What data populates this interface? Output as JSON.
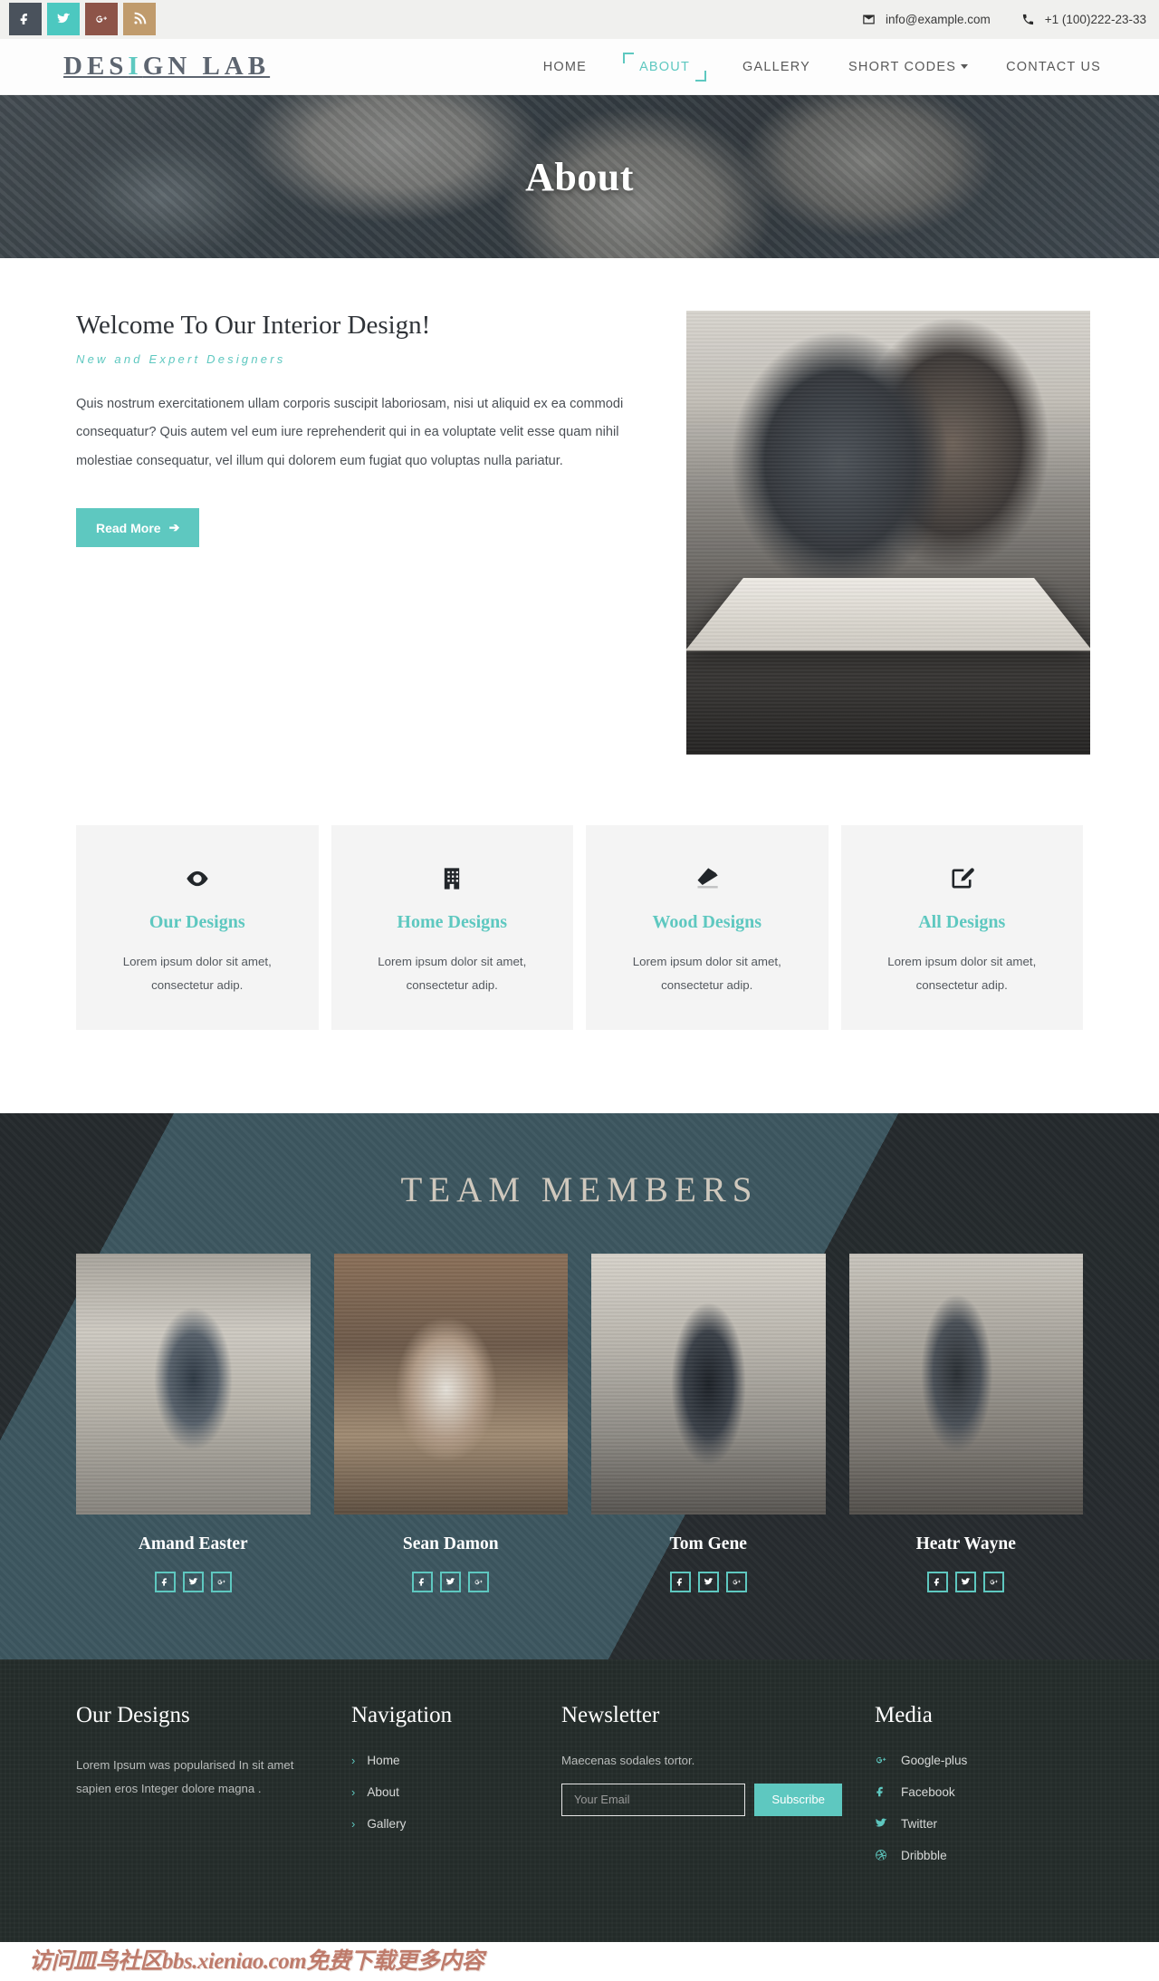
{
  "topbar": {
    "socials": [
      {
        "name": "facebook",
        "icon": "facebook-icon",
        "color": "#4a525c"
      },
      {
        "name": "twitter",
        "icon": "twitter-icon",
        "color": "#4cc8c0"
      },
      {
        "name": "google-plus",
        "icon": "google-plus-icon",
        "color": "#8d5448"
      },
      {
        "name": "rss",
        "icon": "rss-icon",
        "color": "#c09b6c"
      }
    ],
    "email": "info@example.com",
    "phone": "+1 (100)222-23-33"
  },
  "header": {
    "logo_part1": "DES",
    "logo_highlight": "I",
    "logo_part2": "GN LAB",
    "nav": [
      {
        "label": "HOME",
        "active": false,
        "dropdown": false
      },
      {
        "label": "ABOUT",
        "active": true,
        "dropdown": false
      },
      {
        "label": "GALLERY",
        "active": false,
        "dropdown": false
      },
      {
        "label": "SHORT CODES",
        "active": false,
        "dropdown": true
      },
      {
        "label": "CONTACT US",
        "active": false,
        "dropdown": false
      }
    ]
  },
  "hero": {
    "title": "About"
  },
  "welcome": {
    "heading": "Welcome To Our Interior Design!",
    "subheading": "New and Expert Designers",
    "paragraph": "Quis nostrum exercitationem ullam corporis suscipit laboriosam, nisi ut aliquid ex ea commodi consequatur? Quis autem vel eum iure reprehenderit qui in ea voluptate velit esse quam nihil molestiae consequatur, vel illum qui dolorem eum fugiat quo voluptas nulla pariatur.",
    "button": "Read More"
  },
  "cards": [
    {
      "icon": "eye-icon",
      "title": "Our Designs",
      "text": "Lorem ipsum dolor sit amet, consectetur adip."
    },
    {
      "icon": "building-icon",
      "title": "Home Designs",
      "text": "Lorem ipsum dolor sit amet, consectetur adip."
    },
    {
      "icon": "eraser-icon",
      "title": "Wood Designs",
      "text": "Lorem ipsum dolor sit amet, consectetur adip."
    },
    {
      "icon": "pencil-square-icon",
      "title": "All Designs",
      "text": "Lorem ipsum dolor sit amet, consectetur adip."
    }
  ],
  "team": {
    "heading": "TEAM MEMBERS",
    "members": [
      {
        "name": "Amand Easter"
      },
      {
        "name": "Sean Damon"
      },
      {
        "name": "Tom Gene"
      },
      {
        "name": "Heatr Wayne"
      }
    ]
  },
  "footer": {
    "about": {
      "title": "Our Designs",
      "text": "Lorem Ipsum was popularised In sit amet sapien eros Integer dolore magna ."
    },
    "navigation": {
      "title": "Navigation",
      "links": [
        "Home",
        "About",
        "Gallery"
      ]
    },
    "newsletter": {
      "title": "Newsletter",
      "note": "Maecenas sodales tortor.",
      "placeholder": "Your Email",
      "value": "",
      "button": "Subscribe"
    },
    "media": {
      "title": "Media",
      "links": [
        {
          "label": "Google-plus",
          "icon": "google-plus-icon"
        },
        {
          "label": "Facebook",
          "icon": "facebook-icon"
        },
        {
          "label": "Twitter",
          "icon": "twitter-icon"
        },
        {
          "label": "Dribbble",
          "icon": "dribbble-icon"
        }
      ]
    }
  },
  "watermark": "访问皿鸟社区bbs.xieniao.com免费下载更多内容",
  "colors": {
    "accent": "#5ec8c0",
    "dark": "#232b29",
    "team_bg": "#3d5760"
  }
}
